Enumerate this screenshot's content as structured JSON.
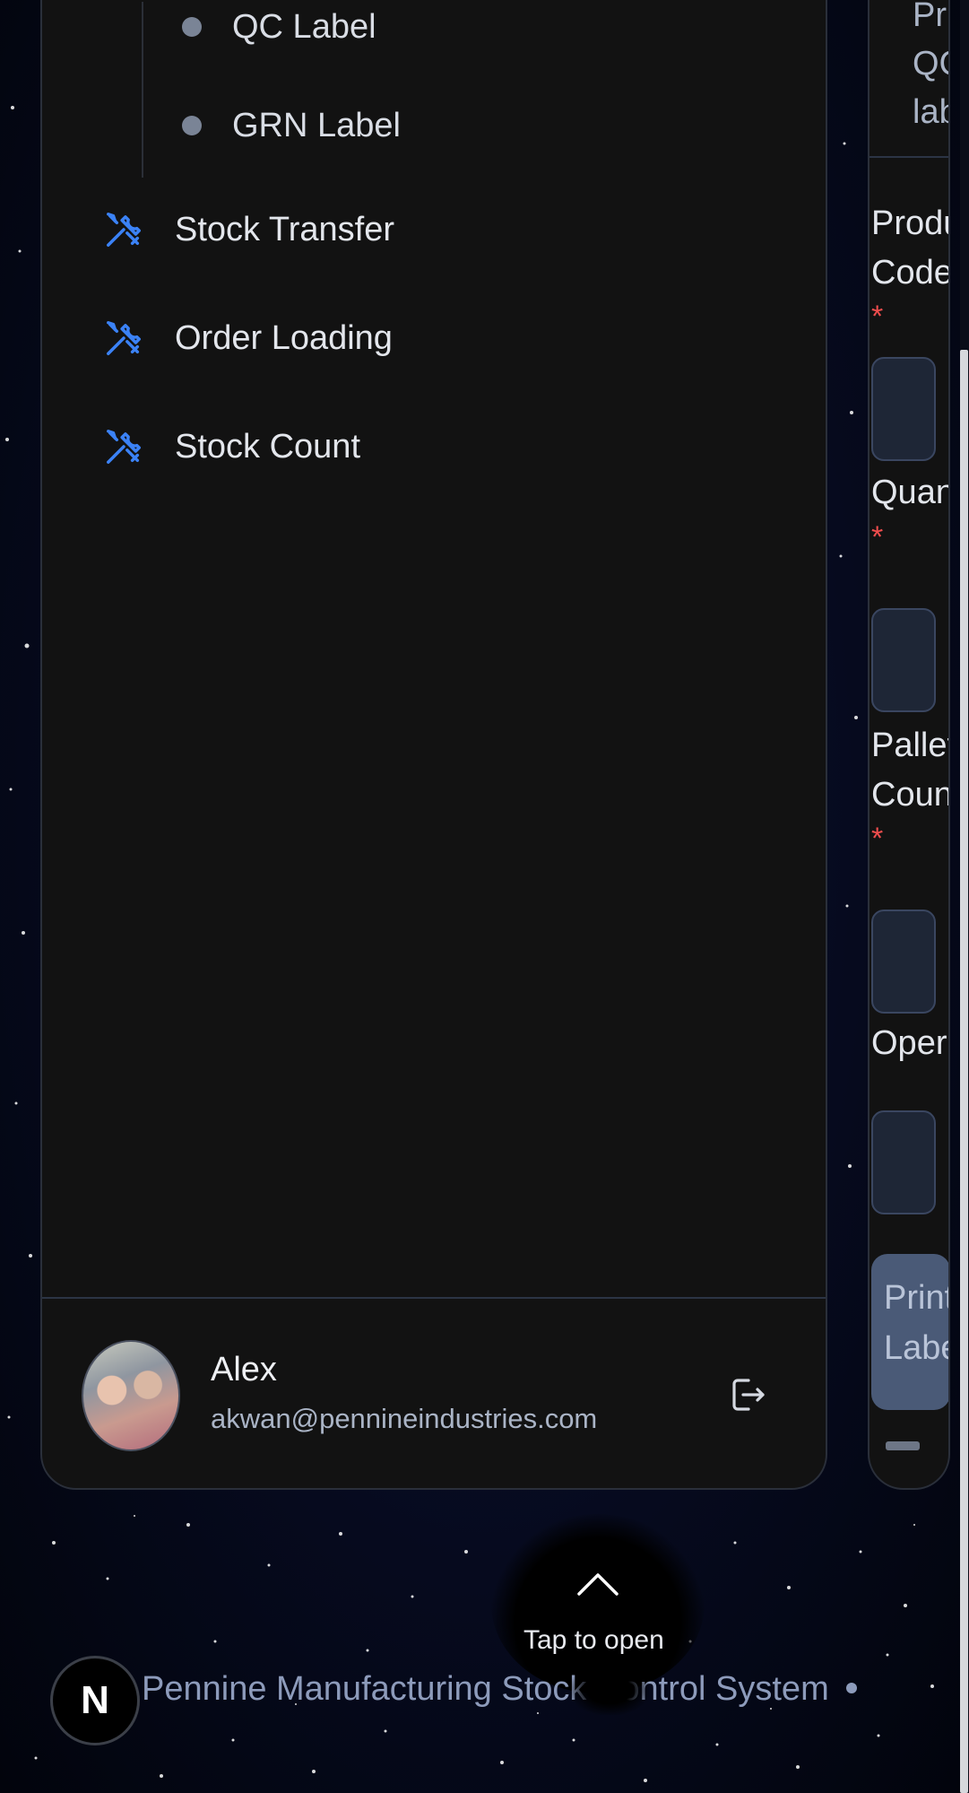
{
  "sidebar": {
    "sub_items": [
      {
        "label": "QC Label"
      },
      {
        "label": "GRN Label"
      }
    ],
    "items": [
      {
        "label": "Stock Transfer",
        "icon": "tools-icon"
      },
      {
        "label": "Order Loading",
        "icon": "tools-icon"
      },
      {
        "label": "Stock Count",
        "icon": "tools-icon"
      }
    ],
    "user": {
      "name": "Alex",
      "email": "akwan@pennineindustries.com"
    }
  },
  "form_panel": {
    "header_lines": [
      "Pri",
      "QC",
      "lab"
    ],
    "fields": [
      {
        "label_lines": [
          "Produ",
          "Code"
        ],
        "required": "*"
      },
      {
        "label_lines": [
          "Quan"
        ],
        "required": "*"
      },
      {
        "label_lines": [
          "Pallet",
          "Coun"
        ],
        "required": "*"
      },
      {
        "label_lines": [
          "Oper"
        ]
      }
    ],
    "button_lines": [
      "Print",
      "Labe"
    ]
  },
  "tap_to_open": "Tap to open",
  "footer": {
    "logo_letter": "N",
    "system_name": "Pennine Manufacturing Stock Control System"
  },
  "colors": {
    "accent_icon": "#3b82f6",
    "required": "#ef4d4d",
    "background": "#060a1e"
  }
}
